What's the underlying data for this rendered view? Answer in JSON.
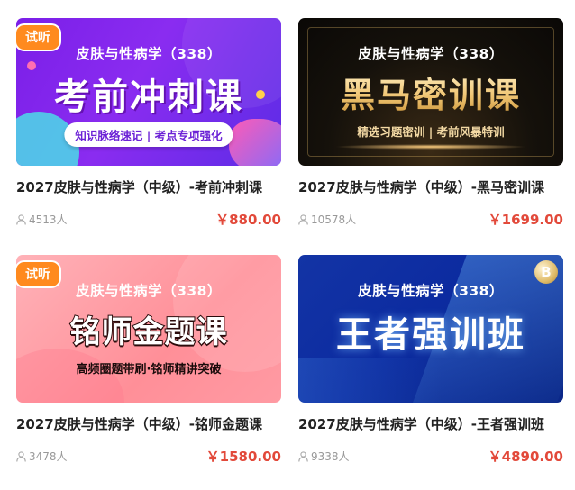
{
  "courses": [
    {
      "trial_badge": "试听",
      "cover_subject": "皮肤与性病学（338）",
      "cover_headline": "考前冲刺课",
      "cover_tagline": "知识脉络速记 | 考点专项强化",
      "title": "2027皮肤与性病学（中级）-考前冲刺课",
      "enrolled": "4513人",
      "price": "￥880.00"
    },
    {
      "trial_badge": "",
      "cover_subject": "皮肤与性病学（338）",
      "cover_headline": "黑马密训课",
      "cover_tagline": "精选习题密训 | 考前风暴特训",
      "title": "2027皮肤与性病学（中级）-黑马密训课",
      "enrolled": "10578人",
      "price": "￥1699.00"
    },
    {
      "trial_badge": "试听",
      "cover_subject": "皮肤与性病学（338）",
      "cover_headline": "铭师金题课",
      "cover_tagline": "高频圈题带刷·铭师精讲突破",
      "title": "2027皮肤与性病学（中级）-铭师金题课",
      "enrolled": "3478人",
      "price": "￥1580.00"
    },
    {
      "trial_badge": "",
      "cover_subject": "皮肤与性病学（338）",
      "cover_headline": "王者强训班",
      "cover_badge": "B",
      "title": "2027皮肤与性病学（中级）-王者强训班",
      "enrolled": "9338人",
      "price": "￥4890.00"
    }
  ],
  "icons": {
    "enrolled": "user-icon"
  },
  "colors": {
    "price": "#e2493a",
    "trial_badge": "#ff8a1e",
    "meta_text": "#999999"
  }
}
